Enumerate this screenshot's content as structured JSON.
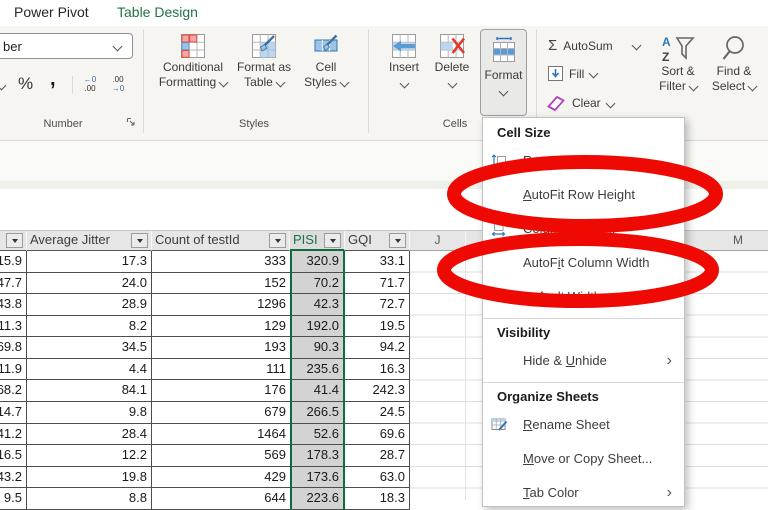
{
  "tab_bar": {
    "power_pivot": "Power Pivot",
    "table_design": "Table Design"
  },
  "ribbon": {
    "number_group": {
      "combo_value": "ber",
      "percent_label": "%",
      "comma_label": ",",
      "increase_decimal": {
        "top": "←0",
        "bottom": ".00"
      },
      "decrease_decimal": {
        "top": ".00",
        "bottom": "→0"
      },
      "group_label": "Number"
    },
    "styles_group": {
      "conditional_formatting_line1": "Conditional",
      "conditional_formatting_line2": "Formatting",
      "format_as_table_line1": "Format as",
      "format_as_table_line2": "Table",
      "cell_styles_line1": "Cell",
      "cell_styles_line2": "Styles",
      "group_label": "Styles"
    },
    "cells_group": {
      "insert_label": "Insert",
      "delete_label": "Delete",
      "format_label": "Format",
      "group_label": "Cells"
    },
    "editing_group": {
      "sigma": "Σ",
      "autosum_label": "AutoSum",
      "fill_label": "Fill",
      "clear_label": "Clear",
      "sort_filter_line1": "Sort &",
      "sort_filter_line2": "Filter",
      "find_select_line1": "Find &",
      "find_select_line2": "Select"
    }
  },
  "format_menu": {
    "sections": [
      {
        "header": "Cell Size",
        "items": [
          {
            "label": "Row Height...",
            "accel": null,
            "icon": "row-height-icon"
          },
          {
            "label": "AutoFit Row Height",
            "accel": 0
          },
          {
            "label": "Column Width...",
            "accel": null,
            "icon": "column-width-icon"
          },
          {
            "label": "AutoFit Column Width",
            "accel": 5
          },
          {
            "label": "Default Width...",
            "accel": 0
          }
        ]
      },
      {
        "header": "Visibility",
        "items": [
          {
            "label": "Hide & Unhide",
            "accel": 7,
            "submenu": true
          }
        ]
      },
      {
        "header": "Organize Sheets",
        "items": [
          {
            "label": "Rename Sheet",
            "accel": 0,
            "icon": "rename-sheet-icon"
          },
          {
            "label": "Move or Copy Sheet...",
            "accel": 0
          },
          {
            "label": "Tab Color",
            "accel": 0,
            "submenu": true
          }
        ]
      }
    ]
  },
  "sheet": {
    "column_letters": {
      "j": "J",
      "m": "M"
    },
    "table": {
      "headers": [
        "Average Jitter",
        "Count of testId",
        "PISI",
        "GQI"
      ],
      "selected_column": "PISI",
      "rows": [
        [
          "15.9",
          "17.3",
          "333",
          "320.9",
          "33.1"
        ],
        [
          "47.7",
          "24.0",
          "152",
          "70.2",
          "71.7"
        ],
        [
          "43.8",
          "28.9",
          "1296",
          "42.3",
          "72.7"
        ],
        [
          "11.3",
          "8.2",
          "129",
          "192.0",
          "19.5"
        ],
        [
          "69.8",
          "34.5",
          "193",
          "90.3",
          "94.2"
        ],
        [
          "11.9",
          "4.4",
          "111",
          "235.6",
          "16.3"
        ],
        [
          "68.2",
          "84.1",
          "176",
          "41.4",
          "242.3"
        ],
        [
          "14.7",
          "9.8",
          "679",
          "266.5",
          "24.5"
        ],
        [
          "41.2",
          "28.4",
          "1464",
          "52.6",
          "69.6"
        ],
        [
          "16.5",
          "12.2",
          "569",
          "178.3",
          "28.7"
        ],
        [
          "43.2",
          "19.8",
          "429",
          "173.6",
          "63.0"
        ],
        [
          "9.5",
          "8.8",
          "644",
          "223.6",
          "18.3"
        ]
      ]
    }
  },
  "annotation": {
    "highlight_color": "#ee0a02"
  }
}
